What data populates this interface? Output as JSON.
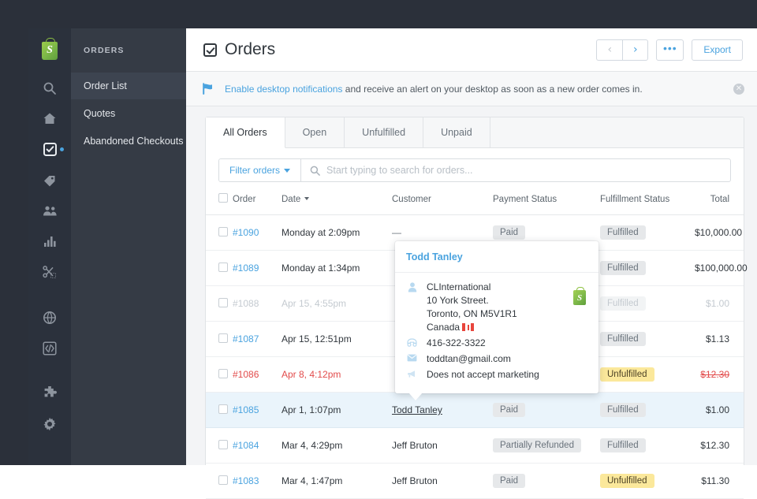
{
  "rail": {
    "logo": "shopify-bag-logo",
    "icons": [
      {
        "name": "search-icon"
      },
      {
        "name": "home-icon"
      },
      {
        "name": "orders-icon",
        "badge": true,
        "active": true
      },
      {
        "name": "tag-icon"
      },
      {
        "name": "customers-icon"
      },
      {
        "name": "analytics-icon"
      },
      {
        "name": "discounts-icon"
      },
      {
        "name": "globe-icon"
      },
      {
        "name": "code-icon"
      },
      {
        "name": "apps-icon"
      },
      {
        "name": "settings-icon"
      }
    ]
  },
  "sidebar": {
    "title": "ORDERS",
    "items": [
      {
        "label": "Order List",
        "selected": true
      },
      {
        "label": "Quotes",
        "selected": false
      },
      {
        "label": "Abandoned Checkouts",
        "selected": false
      }
    ]
  },
  "header": {
    "title": "Orders",
    "prev_label": "‹",
    "next_label": "›",
    "more_label": "•••",
    "export_label": "Export"
  },
  "notice": {
    "link_text": "Enable desktop notifications",
    "rest_text": " and receive an alert on your desktop as soon as a new order comes in.",
    "close_label": "✕",
    "flag_color": "#4aa3df"
  },
  "tabs": [
    {
      "label": "All Orders",
      "active": true
    },
    {
      "label": "Open",
      "active": false
    },
    {
      "label": "Unfulfilled",
      "active": false
    },
    {
      "label": "Unpaid",
      "active": false
    }
  ],
  "filter": {
    "button_label": "Filter orders",
    "search_placeholder": "Start typing to search for orders..."
  },
  "table": {
    "columns": [
      "Order",
      "Date",
      "Customer",
      "Payment Status",
      "Fulfillment Status",
      "Total"
    ],
    "sorted_column": "Date",
    "rows": [
      {
        "order": "#1090",
        "date": "Monday at 2:09pm",
        "customer": "—",
        "customer_dash": true,
        "payment": "Paid",
        "payment_style": "default",
        "fulfillment": "Fulfilled",
        "fulfillment_style": "default",
        "total": "$10,000.00",
        "style": "normal"
      },
      {
        "order": "#1089",
        "date": "Monday at 1:34pm",
        "customer": "",
        "customer_dash": false,
        "payment": "",
        "payment_style": "none",
        "fulfillment": "Fulfilled",
        "fulfillment_style": "default",
        "total": "$100,000.00",
        "style": "normal"
      },
      {
        "order": "#1088",
        "date": "Apr 15, 4:55pm",
        "customer": "",
        "customer_dash": false,
        "payment": "",
        "payment_style": "none",
        "fulfillment": "Fulfilled",
        "fulfillment_style": "default",
        "total": "$1.00",
        "style": "muted"
      },
      {
        "order": "#1087",
        "date": "Apr 15, 12:51pm",
        "customer": "",
        "customer_dash": false,
        "payment": "",
        "payment_style": "none",
        "fulfillment": "Fulfilled",
        "fulfillment_style": "default",
        "total": "$1.13",
        "style": "normal"
      },
      {
        "order": "#1086",
        "date": "Apr 8, 4:12pm",
        "customer": "",
        "customer_dash": false,
        "payment": "",
        "payment_style": "none",
        "fulfillment": "Unfulfilled",
        "fulfillment_style": "warn",
        "total": "$12.30",
        "style": "alert"
      },
      {
        "order": "#1085",
        "date": "Apr 1, 1:07pm",
        "customer": "Todd Tanley",
        "customer_dash": false,
        "payment": "Paid",
        "payment_style": "default",
        "fulfillment": "Fulfilled",
        "fulfillment_style": "default",
        "total": "$1.00",
        "style": "selected"
      },
      {
        "order": "#1084",
        "date": "Mar 4, 4:29pm",
        "customer": "Jeff Bruton",
        "customer_dash": false,
        "payment": "Partially Refunded",
        "payment_style": "default",
        "fulfillment": "Fulfilled",
        "fulfillment_style": "default",
        "total": "$12.30",
        "style": "normal"
      },
      {
        "order": "#1083",
        "date": "Mar 4, 1:47pm",
        "customer": "Jeff Bruton",
        "customer_dash": false,
        "payment": "Paid",
        "payment_style": "default",
        "fulfillment": "Unfulfilled",
        "fulfillment_style": "warn",
        "total": "$11.30",
        "style": "normal"
      }
    ]
  },
  "popover": {
    "name": "Todd Tanley",
    "company": "CLInternational",
    "street": "10 York Street.",
    "city_region": "Toronto, ON M5V1R1",
    "country": "Canada",
    "country_flag": "canada-flag",
    "phone": "416-322-3322",
    "email": "toddtan@gmail.com",
    "marketing": "Does not accept marketing"
  },
  "colors": {
    "accent_blue": "#4aa3df",
    "warn_yellow": "#fbe89b",
    "alert_red": "#e24b4b",
    "rail_dark": "#2b313c",
    "sidebar_dark": "#353b45"
  }
}
